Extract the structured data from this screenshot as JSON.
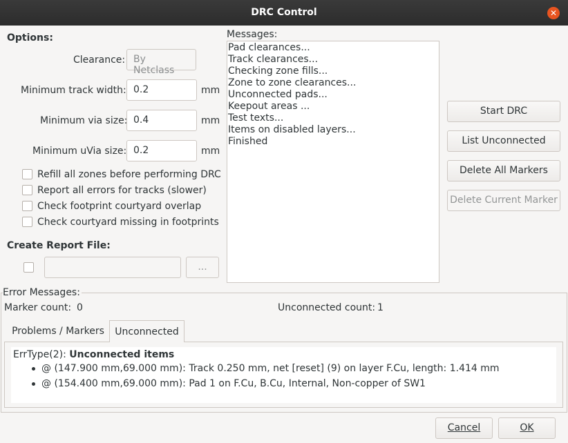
{
  "window": {
    "title": "DRC Control"
  },
  "options": {
    "heading": "Options:",
    "clearance_label": "Clearance:",
    "clearance_value": "By Netclass",
    "min_track_width_label": "Minimum track width:",
    "min_track_width_value": "0.2",
    "min_via_size_label": "Minimum via size:",
    "min_via_size_value": "0.4",
    "min_uvia_size_label": "Minimum uVia size:",
    "min_uvia_size_value": "0.2",
    "unit": "mm",
    "checkboxes": [
      {
        "label": "Refill all zones before performing DRC",
        "checked": false
      },
      {
        "label": "Report all errors for tracks (slower)",
        "checked": false
      },
      {
        "label": "Check footprint courtyard overlap",
        "checked": false
      },
      {
        "label": "Check courtyard missing in footprints",
        "checked": false
      }
    ]
  },
  "report": {
    "heading": "Create Report File:",
    "checked": false,
    "path": "",
    "browse_label": "..."
  },
  "messages": {
    "label": "Messages:",
    "lines": [
      "Pad clearances...",
      "Track clearances...",
      "Checking zone fills...",
      "Zone to zone clearances...",
      "Unconnected pads...",
      "Keepout areas ...",
      "Test texts...",
      "Items on disabled layers...",
      "Finished"
    ]
  },
  "actions": {
    "start_drc": "Start DRC",
    "list_unconnected": "List Unconnected",
    "delete_all_markers": "Delete All Markers",
    "delete_current_marker": "Delete Current Marker"
  },
  "errors": {
    "group_label": "Error Messages:",
    "marker_count_label": "Marker count:",
    "marker_count": "0",
    "unconnected_count_label": "Unconnected count:",
    "unconnected_count": "1",
    "tabs": [
      "Problems / Markers",
      "Unconnected"
    ],
    "active_tab": "Unconnected",
    "err_type": "ErrType(2): ",
    "err_title": "Unconnected items",
    "items": [
      "@ (147.900 mm,69.000 mm): Track 0.250 mm, net [reset] (9) on layer F.Cu, length: 1.414 mm",
      "@ (154.400 mm,69.000 mm): Pad 1 on F.Cu, B.Cu, Internal, Non-copper of SW1"
    ]
  },
  "footer": {
    "cancel_label": "Cancel",
    "ok_label": "OK"
  },
  "colors": {
    "titlebar": "#2c2c2c",
    "close_button": "#e95420",
    "window_bg": "#f6f5f4"
  }
}
